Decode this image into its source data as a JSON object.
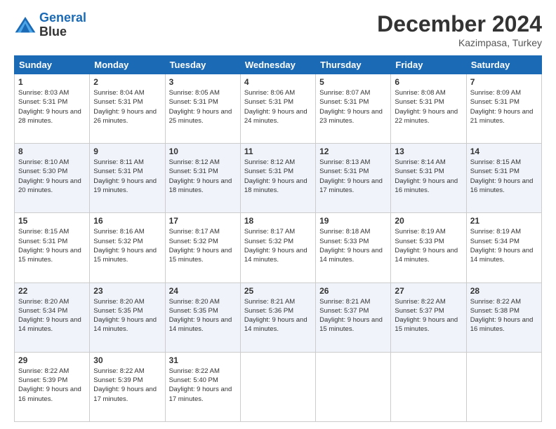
{
  "header": {
    "logo_line1": "General",
    "logo_line2": "Blue",
    "month_year": "December 2024",
    "location": "Kazimpasa, Turkey"
  },
  "weekdays": [
    "Sunday",
    "Monday",
    "Tuesday",
    "Wednesday",
    "Thursday",
    "Friday",
    "Saturday"
  ],
  "weeks": [
    [
      {
        "day": "1",
        "sunrise": "8:03 AM",
        "sunset": "5:31 PM",
        "daylight": "9 hours and 28 minutes."
      },
      {
        "day": "2",
        "sunrise": "8:04 AM",
        "sunset": "5:31 PM",
        "daylight": "9 hours and 26 minutes."
      },
      {
        "day": "3",
        "sunrise": "8:05 AM",
        "sunset": "5:31 PM",
        "daylight": "9 hours and 25 minutes."
      },
      {
        "day": "4",
        "sunrise": "8:06 AM",
        "sunset": "5:31 PM",
        "daylight": "9 hours and 24 minutes."
      },
      {
        "day": "5",
        "sunrise": "8:07 AM",
        "sunset": "5:31 PM",
        "daylight": "9 hours and 23 minutes."
      },
      {
        "day": "6",
        "sunrise": "8:08 AM",
        "sunset": "5:31 PM",
        "daylight": "9 hours and 22 minutes."
      },
      {
        "day": "7",
        "sunrise": "8:09 AM",
        "sunset": "5:31 PM",
        "daylight": "9 hours and 21 minutes."
      }
    ],
    [
      {
        "day": "8",
        "sunrise": "8:10 AM",
        "sunset": "5:30 PM",
        "daylight": "9 hours and 20 minutes."
      },
      {
        "day": "9",
        "sunrise": "8:11 AM",
        "sunset": "5:31 PM",
        "daylight": "9 hours and 19 minutes."
      },
      {
        "day": "10",
        "sunrise": "8:12 AM",
        "sunset": "5:31 PM",
        "daylight": "9 hours and 18 minutes."
      },
      {
        "day": "11",
        "sunrise": "8:12 AM",
        "sunset": "5:31 PM",
        "daylight": "9 hours and 18 minutes."
      },
      {
        "day": "12",
        "sunrise": "8:13 AM",
        "sunset": "5:31 PM",
        "daylight": "9 hours and 17 minutes."
      },
      {
        "day": "13",
        "sunrise": "8:14 AM",
        "sunset": "5:31 PM",
        "daylight": "9 hours and 16 minutes."
      },
      {
        "day": "14",
        "sunrise": "8:15 AM",
        "sunset": "5:31 PM",
        "daylight": "9 hours and 16 minutes."
      }
    ],
    [
      {
        "day": "15",
        "sunrise": "8:15 AM",
        "sunset": "5:31 PM",
        "daylight": "9 hours and 15 minutes."
      },
      {
        "day": "16",
        "sunrise": "8:16 AM",
        "sunset": "5:32 PM",
        "daylight": "9 hours and 15 minutes."
      },
      {
        "day": "17",
        "sunrise": "8:17 AM",
        "sunset": "5:32 PM",
        "daylight": "9 hours and 15 minutes."
      },
      {
        "day": "18",
        "sunrise": "8:17 AM",
        "sunset": "5:32 PM",
        "daylight": "9 hours and 14 minutes."
      },
      {
        "day": "19",
        "sunrise": "8:18 AM",
        "sunset": "5:33 PM",
        "daylight": "9 hours and 14 minutes."
      },
      {
        "day": "20",
        "sunrise": "8:19 AM",
        "sunset": "5:33 PM",
        "daylight": "9 hours and 14 minutes."
      },
      {
        "day": "21",
        "sunrise": "8:19 AM",
        "sunset": "5:34 PM",
        "daylight": "9 hours and 14 minutes."
      }
    ],
    [
      {
        "day": "22",
        "sunrise": "8:20 AM",
        "sunset": "5:34 PM",
        "daylight": "9 hours and 14 minutes."
      },
      {
        "day": "23",
        "sunrise": "8:20 AM",
        "sunset": "5:35 PM",
        "daylight": "9 hours and 14 minutes."
      },
      {
        "day": "24",
        "sunrise": "8:20 AM",
        "sunset": "5:35 PM",
        "daylight": "9 hours and 14 minutes."
      },
      {
        "day": "25",
        "sunrise": "8:21 AM",
        "sunset": "5:36 PM",
        "daylight": "9 hours and 14 minutes."
      },
      {
        "day": "26",
        "sunrise": "8:21 AM",
        "sunset": "5:37 PM",
        "daylight": "9 hours and 15 minutes."
      },
      {
        "day": "27",
        "sunrise": "8:22 AM",
        "sunset": "5:37 PM",
        "daylight": "9 hours and 15 minutes."
      },
      {
        "day": "28",
        "sunrise": "8:22 AM",
        "sunset": "5:38 PM",
        "daylight": "9 hours and 16 minutes."
      }
    ],
    [
      {
        "day": "29",
        "sunrise": "8:22 AM",
        "sunset": "5:39 PM",
        "daylight": "9 hours and 16 minutes."
      },
      {
        "day": "30",
        "sunrise": "8:22 AM",
        "sunset": "5:39 PM",
        "daylight": "9 hours and 17 minutes."
      },
      {
        "day": "31",
        "sunrise": "8:22 AM",
        "sunset": "5:40 PM",
        "daylight": "9 hours and 17 minutes."
      },
      null,
      null,
      null,
      null
    ]
  ]
}
